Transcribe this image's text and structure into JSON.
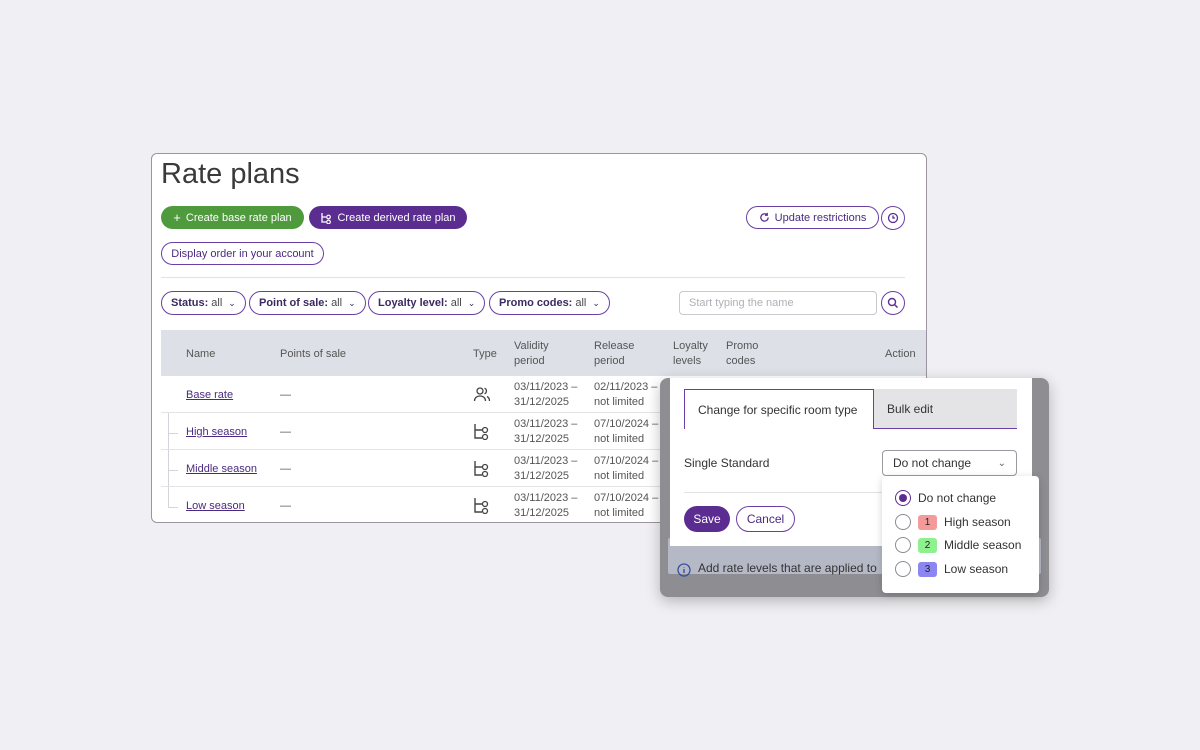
{
  "page": {
    "title": "Rate plans",
    "buttons": {
      "create_base": "Create base rate plan",
      "create_derived": "Create derived rate plan",
      "display_order": "Display order in your account",
      "update_restrictions": "Update restrictions"
    },
    "filters": [
      {
        "label": "Status:",
        "value": "all"
      },
      {
        "label": "Point of sale:",
        "value": "all"
      },
      {
        "label": "Loyalty level:",
        "value": "all"
      },
      {
        "label": "Promo codes:",
        "value": "all"
      }
    ],
    "search": {
      "placeholder": "Start typing the name"
    }
  },
  "table": {
    "headers": {
      "name": "Name",
      "points_of_sale": "Points of sale",
      "type": "Type",
      "validity_1": "Validity",
      "validity_2": "period",
      "release_1": "Release",
      "release_2": "period",
      "loyalty_1": "Loyalty",
      "loyalty_2": "levels",
      "promo_1": "Promo",
      "promo_2": "codes",
      "action": "Action"
    },
    "rows": [
      {
        "name": "Base rate",
        "pos": "—",
        "type_icon": "people-icon",
        "validity_from": "03/11/2023 –",
        "validity_to": "31/12/2025",
        "release_from": "02/11/2023 –",
        "release_to": "not limited"
      },
      {
        "name": "High season",
        "pos": "—",
        "type_icon": "derived-icon",
        "validity_from": "03/11/2023 –",
        "validity_to": "31/12/2025",
        "release_from": "07/10/2024 –",
        "release_to": "not limited"
      },
      {
        "name": "Middle season",
        "pos": "—",
        "type_icon": "derived-icon",
        "validity_from": "03/11/2023 –",
        "validity_to": "31/12/2025",
        "release_from": "07/10/2024 –",
        "release_to": "not limited"
      },
      {
        "name": "Low season",
        "pos": "—",
        "type_icon": "derived-icon",
        "validity_from": "03/11/2023 –",
        "validity_to": "31/12/2025",
        "release_from": "07/10/2024 –",
        "release_to": "not limited"
      }
    ]
  },
  "popup": {
    "tabs": [
      "Change for specific room type",
      "Bulk edit"
    ],
    "room_type": "Single Standard",
    "select_value": "Do not change",
    "save": "Save",
    "cancel": "Cancel",
    "background_notice": "Add rate levels that are applied to",
    "options": [
      {
        "label": "Do not change",
        "badge": "",
        "color": "",
        "checked": true
      },
      {
        "label": "High season",
        "badge": "1",
        "color": "#f59a9a",
        "checked": false
      },
      {
        "label": "Middle season",
        "badge": "2",
        "color": "#8ef08e",
        "checked": false
      },
      {
        "label": "Low season",
        "badge": "3",
        "color": "#8c86f0",
        "checked": false
      }
    ]
  },
  "colors": {
    "accent": "#5c2d91",
    "green": "#4e9a3c"
  }
}
